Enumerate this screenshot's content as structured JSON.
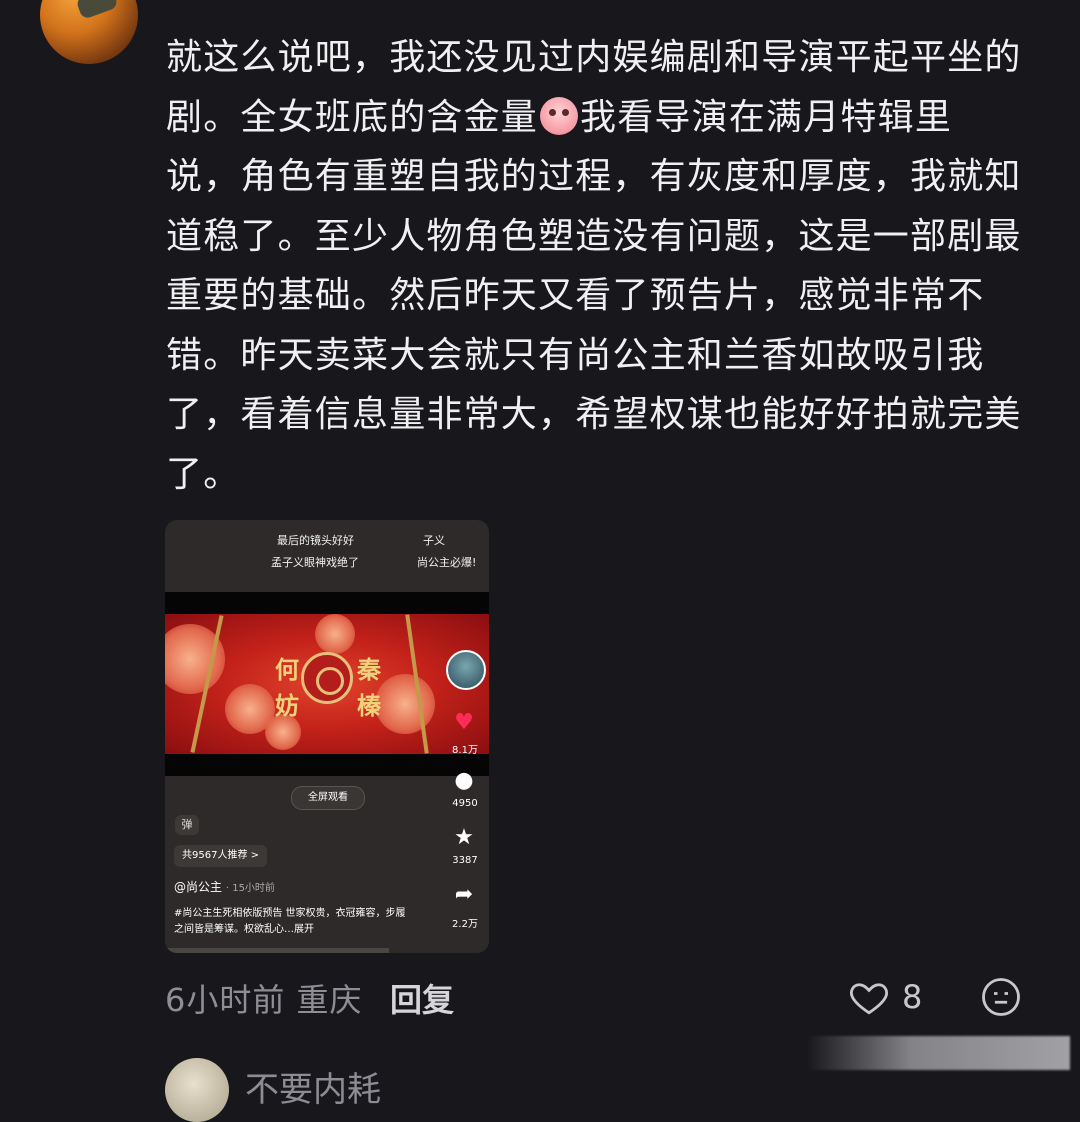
{
  "comment_top": {
    "username": "",
    "text_parts": [
      "就这么说吧，我还没见过内娱编剧和导演平起平坐的\n剧。全女班底的含金量",
      "我看导演在满月特辑里\n说，角色有重塑自我的过程，有灰度和厚度，我就知\n道稳了。至少人物角色塑造没有问题，这是一部剧最\n重要的基础。然后昨天又看了预告片，感觉非常不\n错。昨天卖菜大会就只有尚公主和兰香如故吸引我\n了，看着信息量非常大，希望权谋也能好好拍就完美\n了。"
    ],
    "emoji": "crying-face-emoji",
    "time": "6小时前",
    "location": "重庆",
    "reply_label": "回复",
    "like_count": "8"
  },
  "video_card": {
    "danmaku": [
      "最后的镜头好好",
      "子义",
      "孟子义眼神戏绝了",
      "尚公主必爆!"
    ],
    "banner_chars": [
      "何",
      "妨",
      "秦",
      "榛"
    ],
    "likes": "8.1万",
    "comments": "4950",
    "favorites": "3387",
    "shares": "2.2万",
    "fullscreen_label": "全屏观看",
    "small_chip": "弹",
    "recommend": "共9567人推荐 >",
    "author": "@尚公主",
    "post_time": "· 15小时前",
    "description": "#尚公主生死相依版预告 世家权贵，衣冠雍容，步履之间皆是筹谋。权欲乱心…展开"
  },
  "next_comment": {
    "username": "不要内耗"
  },
  "colors": {
    "background": "#18181c",
    "text": "#f0f0f2",
    "muted": "#8e8e94",
    "heart": "#ff2d55"
  }
}
